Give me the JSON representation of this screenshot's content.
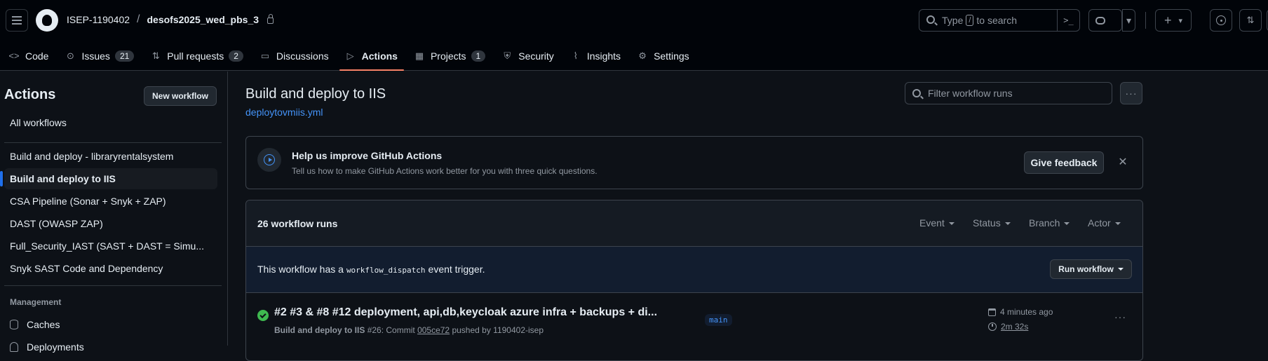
{
  "header": {
    "owner": "ISEP-1190402",
    "separator": "/",
    "repo": "desofs2025_wed_pbs_3",
    "search": {
      "prefix": "Type",
      "key": "/",
      "suffix": "to search",
      "command_glyph": ">_"
    },
    "buttons": {
      "plus": "+",
      "caret": "▾"
    }
  },
  "nav": {
    "tabs": [
      {
        "label": "Code",
        "icon": "code-icon",
        "glyph": "<>"
      },
      {
        "label": "Issues",
        "icon": "issue-icon",
        "glyph": "⊙",
        "count": "21"
      },
      {
        "label": "Pull requests",
        "icon": "pull-request-icon",
        "glyph": "⇅",
        "count": "2"
      },
      {
        "label": "Discussions",
        "icon": "discussion-icon",
        "glyph": "▭"
      },
      {
        "label": "Actions",
        "icon": "play-icon",
        "glyph": "▷",
        "active": true
      },
      {
        "label": "Projects",
        "icon": "table-icon",
        "glyph": "▦",
        "count": "1"
      },
      {
        "label": "Security",
        "icon": "shield-icon",
        "glyph": "⛨"
      },
      {
        "label": "Insights",
        "icon": "graph-icon",
        "glyph": "⌇"
      },
      {
        "label": "Settings",
        "icon": "gear-icon",
        "glyph": "⚙"
      }
    ]
  },
  "sidebar": {
    "title": "Actions",
    "new_workflow": "New workflow",
    "all_workflows": "All workflows",
    "workflows": [
      "Build and deploy - libraryrentalsystem",
      "Build and deploy to IIS",
      "CSA Pipeline (Sonar + Snyk + ZAP)",
      "DAST (OWASP ZAP)",
      "Full_Security_IAST (SAST + DAST = Simu...",
      "Snyk SAST Code and Dependency"
    ],
    "management_heading": "Management",
    "management": [
      "Caches",
      "Deployments"
    ]
  },
  "main": {
    "title": "Build and deploy to IIS",
    "file": "deploytovmiis.yml",
    "filter_placeholder": "Filter workflow runs",
    "banner": {
      "title": "Help us improve GitHub Actions",
      "subtitle": "Tell us how to make GitHub Actions work better for you with three quick questions.",
      "feedback": "Give feedback",
      "close": "✕"
    },
    "runs": {
      "count_label": "26 workflow runs",
      "filters": [
        "Event",
        "Status",
        "Branch",
        "Actor"
      ],
      "dispatch_before": "This workflow has a",
      "dispatch_code": "workflow_dispatch",
      "dispatch_after": "event trigger.",
      "run_workflow": "Run workflow",
      "items": [
        {
          "title": "#2 #3 & #8 #12 deployment, api,db,keycloak azure infra + backups + di...",
          "workflow": "Build and deploy to IIS",
          "run_number": "#26: Commit",
          "commit": "005ce72",
          "pushed_by": "pushed by 1190402-isep",
          "branch": "main",
          "time_ago": "4 minutes ago",
          "duration": "2m 32s",
          "status_color": "#3fb950"
        }
      ]
    }
  },
  "colors": {
    "accent": "#4493f8",
    "tab_underline": "#f78166",
    "success": "#3fb950",
    "selected_bar": "#1f6feb"
  }
}
